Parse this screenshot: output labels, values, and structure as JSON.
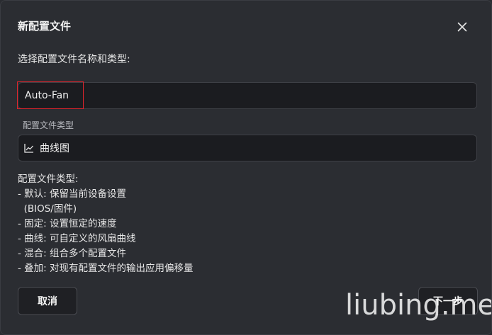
{
  "dialog": {
    "title": "新配置文件",
    "close_icon": "close-icon",
    "subtitle": "选择配置文件名称和类型:",
    "name_input": {
      "value": "Auto-Fan",
      "placeholder": ""
    },
    "type_field": {
      "label": "配置文件类型",
      "icon": "line-chart-icon",
      "value": "曲线图"
    },
    "description": {
      "heading": "配置文件类型:",
      "lines": [
        "- 默认: 保留当前设备设置",
        "  (BIOS/固件)",
        "- 固定: 设置恒定的速度",
        "- 曲线: 可自定义的风扇曲线",
        "- 混合: 组合多个配置文件",
        "- 叠加: 对现有配置文件的输出应用偏移量"
      ]
    },
    "cancel_label": "取消",
    "next_label": "下一步",
    "highlight_color": "#e0242c"
  },
  "watermark": "liubing.me"
}
